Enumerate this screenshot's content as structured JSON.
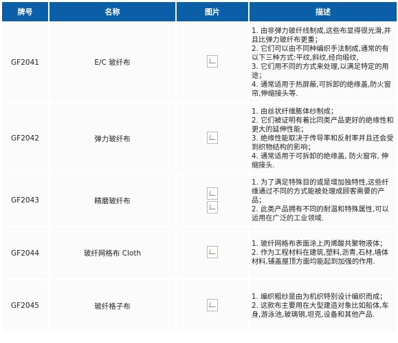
{
  "headers": {
    "code": "牌号",
    "name": "名称",
    "image": "图片",
    "description": "描述"
  },
  "rows": [
    {
      "code": "GF2041",
      "name": "E/C 玻纤布",
      "images": 1,
      "desc": [
        "1. 由非弹力玻纤线制成,这些布显得很光滑,并且比弹力玻纤布更重；",
        "2. 它们可以由不同种编织手法制成,通常的有以下三种方式:平纹,斜纹,经向缎纹,",
        "3. 它们用不同的方式来处理,以满足特定的用途；",
        "4. 通常适用于热屏蔽,可拆卸的绝缘盖,防火窗帘,伸缩接头等."
      ]
    },
    {
      "code": "GF2042",
      "name": "弹力玻纤布",
      "images": 1,
      "desc": [
        "1. 由丝状纤维膨体纱制成；",
        "2. 它们被证明有着比同类产品更好的绝缘性和更大的延伸性能；",
        "3. 绝缘性能取决于传导率和反射率并且还会受到织物结构的影响；",
        "4. 通常适用于可拆卸的绝缘盖, 防火窗帘, 伸缩接头."
      ]
    },
    {
      "code": "GF2043",
      "name": "精磨玻纤布",
      "images": 2,
      "desc": [
        "1. 为了满足特殊目的或是增加独特性,这些纤维通过不同的方式能被处理成顾客需要的产品；",
        "2. 此类产品拥有不同的耐温和特殊属性,可以运用在广泛的工业领域."
      ]
    },
    {
      "code": "GF2044",
      "name": "玻纤网格布 Cloth",
      "images": 1,
      "desc": [
        "1. 玻纤网格布表面涂上丙烯酸共聚物液体；",
        "2. 作为工程材料在建筑,塑料,沥青,石材,墙体材料,铺盖屋顶方面均能起到加强的作用."
      ]
    },
    {
      "code": "GF2045",
      "name": "玻纤格子布",
      "images": 1,
      "desc": [
        "1. 编织粗纱是由为机织特别设计编织而成；",
        "2. 这款布主要用在大型建造对象比如船体,车身,游泳池,玻璃钢,坦克,设备和其他产品."
      ]
    }
  ]
}
